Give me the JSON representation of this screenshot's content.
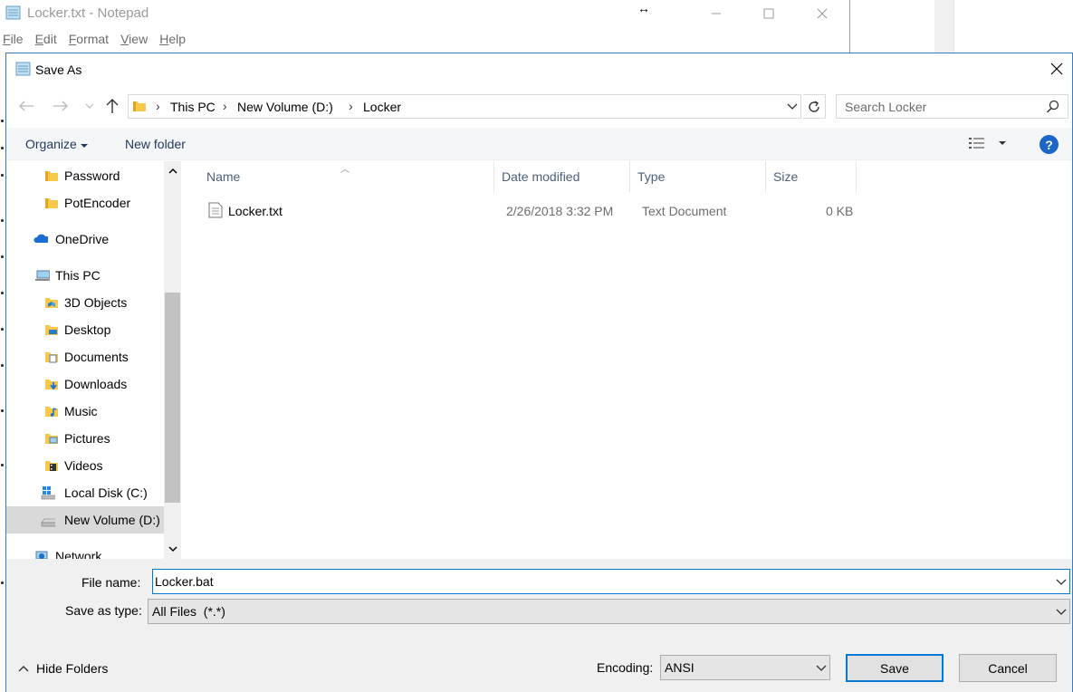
{
  "notepad": {
    "title": "Locker.txt - Notepad",
    "menu": [
      {
        "label": "File",
        "key": "F",
        "rest": "ile"
      },
      {
        "label": "Edit",
        "key": "E",
        "rest": "dit"
      },
      {
        "label": "Format",
        "key": "F",
        "rest": "ormat"
      },
      {
        "label": "View",
        "key": "V",
        "rest": "iew"
      },
      {
        "label": "Help",
        "key": "H",
        "rest": "elp"
      }
    ]
  },
  "dialog": {
    "title": "Save As",
    "breadcrumb": [
      "This PC",
      "New Volume (D:)",
      "Locker"
    ],
    "search_placeholder": "Search Locker",
    "commands": {
      "organize": "Organize",
      "new_folder": "New folder"
    },
    "nav_items": [
      {
        "label": "Password",
        "icon": "folder-icon",
        "indent": 2
      },
      {
        "label": "PotEncoder",
        "icon": "folder-icon",
        "indent": 2
      },
      {
        "label": "OneDrive",
        "icon": "onedrive-icon",
        "indent": 1
      },
      {
        "label": "This PC",
        "icon": "computer-icon",
        "indent": 1
      },
      {
        "label": "3D Objects",
        "icon": "3d-objects-icon",
        "indent": 2
      },
      {
        "label": "Desktop",
        "icon": "desktop-folder-icon",
        "indent": 2
      },
      {
        "label": "Documents",
        "icon": "documents-folder-icon",
        "indent": 2
      },
      {
        "label": "Downloads",
        "icon": "downloads-folder-icon",
        "indent": 2
      },
      {
        "label": "Music",
        "icon": "music-folder-icon",
        "indent": 2
      },
      {
        "label": "Pictures",
        "icon": "pictures-folder-icon",
        "indent": 2
      },
      {
        "label": "Videos",
        "icon": "videos-folder-icon",
        "indent": 2
      },
      {
        "label": "Local Disk (C:)",
        "icon": "windows-drive-icon",
        "indent": 2
      },
      {
        "label": "New Volume (D:)",
        "icon": "drive-icon",
        "indent": 2,
        "selected": true
      },
      {
        "label": "Network",
        "icon": "network-icon",
        "indent": 1
      }
    ],
    "columns": [
      "Name",
      "Date modified",
      "Type",
      "Size"
    ],
    "files": [
      {
        "name": "Locker.txt",
        "date": "2/26/2018 3:32 PM",
        "type": "Text Document",
        "size": "0 KB",
        "icon": "text-file-icon"
      }
    ],
    "file_name_label": "File name:",
    "file_name_value": "Locker.bat",
    "save_type_label": "Save as type:",
    "save_type_value": "All Files  (*.*)",
    "hide_folders": "Hide Folders",
    "encoding_label": "Encoding:",
    "encoding_value": "ANSI",
    "save_button": "Save",
    "cancel_button": "Cancel"
  },
  "colors": {
    "accent": "#0078d7",
    "help_blue": "#1a66c9",
    "folder_yellow": "#f8c84a",
    "selected_bg": "#d9d9d9"
  }
}
